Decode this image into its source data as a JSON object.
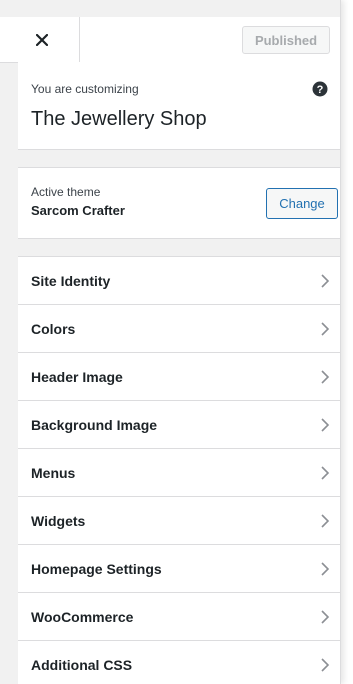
{
  "header": {
    "close_label": "Close",
    "published_label": "Published"
  },
  "customizing": {
    "label": "You are customizing",
    "site_title": "The Jewellery Shop",
    "help_icon": "question-circle-icon"
  },
  "theme": {
    "label": "Active theme",
    "name": "Sarcom Crafter",
    "change_label": "Change"
  },
  "menu": {
    "items": [
      {
        "label": "Site Identity"
      },
      {
        "label": "Colors"
      },
      {
        "label": "Header Image"
      },
      {
        "label": "Background Image"
      },
      {
        "label": "Menus"
      },
      {
        "label": "Widgets"
      },
      {
        "label": "Homepage Settings"
      },
      {
        "label": "WooCommerce"
      },
      {
        "label": "Additional CSS"
      }
    ]
  },
  "colors": {
    "accent": "#2271b1",
    "panel_bg": "#f1f1f1",
    "border": "#dcdcde",
    "text": "#1d2327",
    "muted": "#a7aaad"
  }
}
